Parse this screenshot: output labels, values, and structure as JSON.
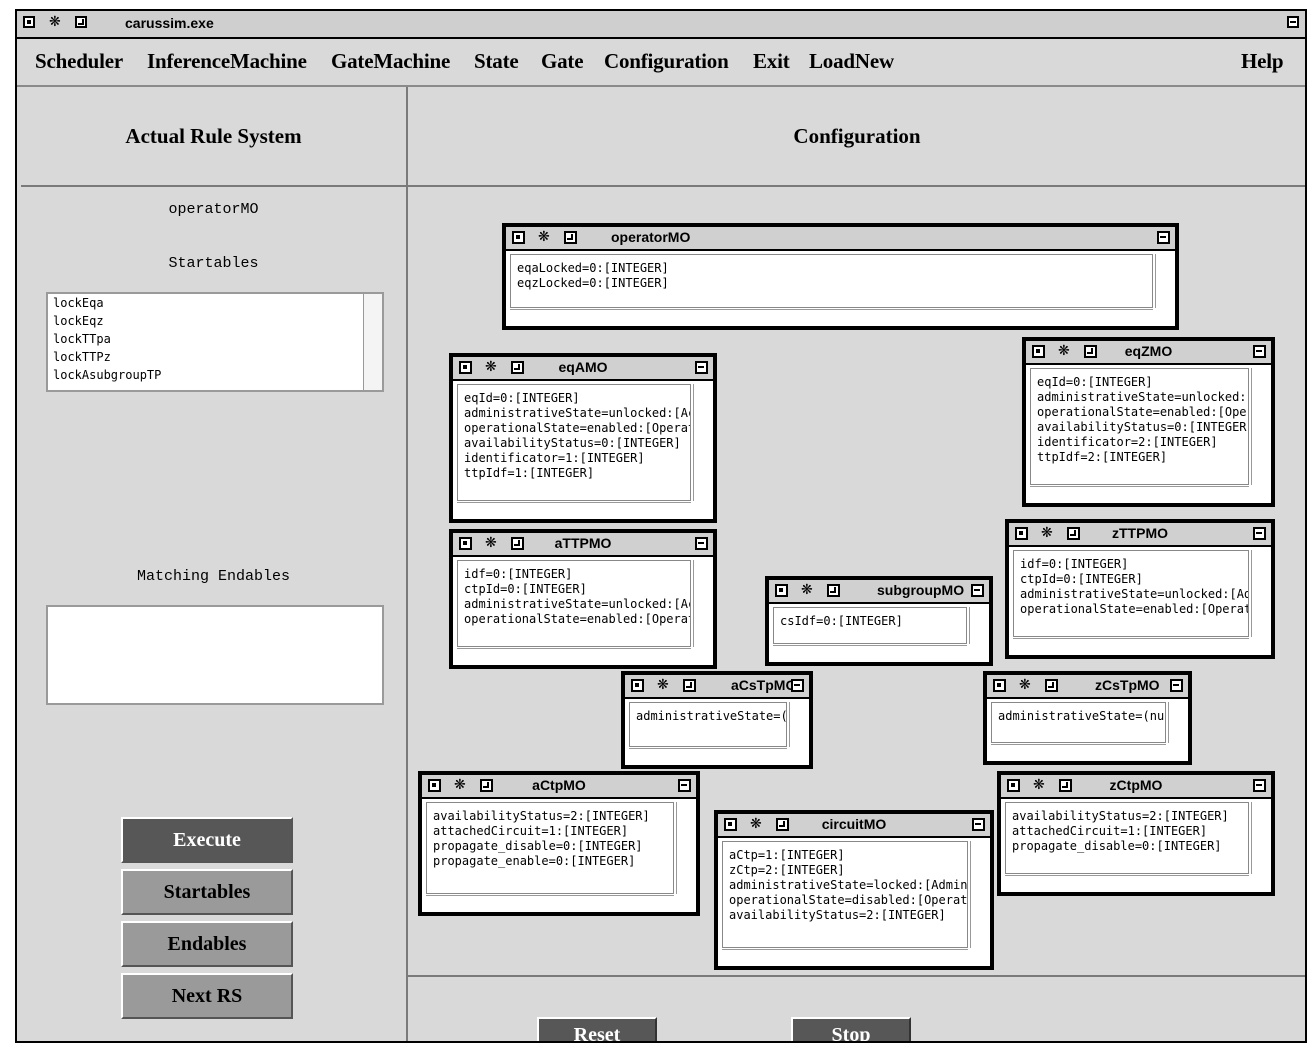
{
  "window": {
    "title": "carussim.exe"
  },
  "menu": [
    "Scheduler",
    "InferenceMachine",
    "GateMachine",
    "State",
    "Gate",
    "Configuration",
    "Exit",
    "LoadNew",
    "Help"
  ],
  "left": {
    "header": "Actual Rule System",
    "current": "operatorMO",
    "startables_label": "Startables",
    "startables": [
      "lockEqa",
      "lockEqz",
      "lockTTpa",
      "lockTTPz",
      "lockAsubgroupTP"
    ],
    "matching_label": "Matching Endables",
    "buttons": [
      "Execute",
      "Startables",
      "Endables",
      "Next RS"
    ]
  },
  "right": {
    "header": "Configuration",
    "buttons": [
      "Reset",
      "Stop"
    ],
    "objects": [
      {
        "title": "operatorMO",
        "lines": [
          "eqaLocked=0:[INTEGER]",
          "eqzLocked=0:[INTEGER]"
        ]
      },
      {
        "title": "eqAMO",
        "lines": [
          "eqId=0:[INTEGER]",
          "administrativeState=unlocked:[Ac",
          "operationalState=enabled:[Operat",
          "availabilityStatus=0:[INTEGER]",
          "identificator=1:[INTEGER]",
          "ttpIdf=1:[INTEGER]"
        ]
      },
      {
        "title": "eqZMO",
        "lines": [
          "eqId=0:[INTEGER]",
          "administrativeState=unlocked:",
          "operationalState=enabled:[Ope",
          "availabilityStatus=0:[INTEGER",
          "identificator=2:[INTEGER]",
          "ttpIdf=2:[INTEGER]"
        ]
      },
      {
        "title": "aTTPMO",
        "lines": [
          "idf=0:[INTEGER]",
          "ctpId=0:[INTEGER]",
          "administrativeState=unlocked:[Ac",
          "operationalState=enabled:[Operat"
        ]
      },
      {
        "title": "zTTPMO",
        "lines": [
          "idf=0:[INTEGER]",
          "ctpId=0:[INTEGER]",
          "administrativeState=unlocked:[Ad",
          "operationalState=enabled:[Operat"
        ]
      },
      {
        "title": "subgroupMO",
        "lines": [
          "csIdf=0:[INTEGER]"
        ]
      },
      {
        "title": "aCsTpMO",
        "lines": [
          "administrativeState=("
        ]
      },
      {
        "title": "zCsTpMO",
        "lines": [
          "administrativeState=(nu"
        ]
      },
      {
        "title": "aCtpMO",
        "lines": [
          "availabilityStatus=2:[INTEGER]",
          "attachedCircuit=1:[INTEGER]",
          "propagate_disable=0:[INTEGER]",
          "propagate_enable=0:[INTEGER]"
        ]
      },
      {
        "title": "circuitMO",
        "lines": [
          "aCtp=1:[INTEGER]",
          "zCtp=2:[INTEGER]",
          "administrativeState=locked:[Admin",
          "operationalState=disabled:[Operat",
          "availabilityStatus=2:[INTEGER]"
        ]
      },
      {
        "title": "zCtpMO",
        "lines": [
          "availabilityStatus=2:[INTEGER]",
          "attachedCircuit=1:[INTEGER]",
          "propagate_disable=0:[INTEGER]"
        ]
      }
    ]
  }
}
